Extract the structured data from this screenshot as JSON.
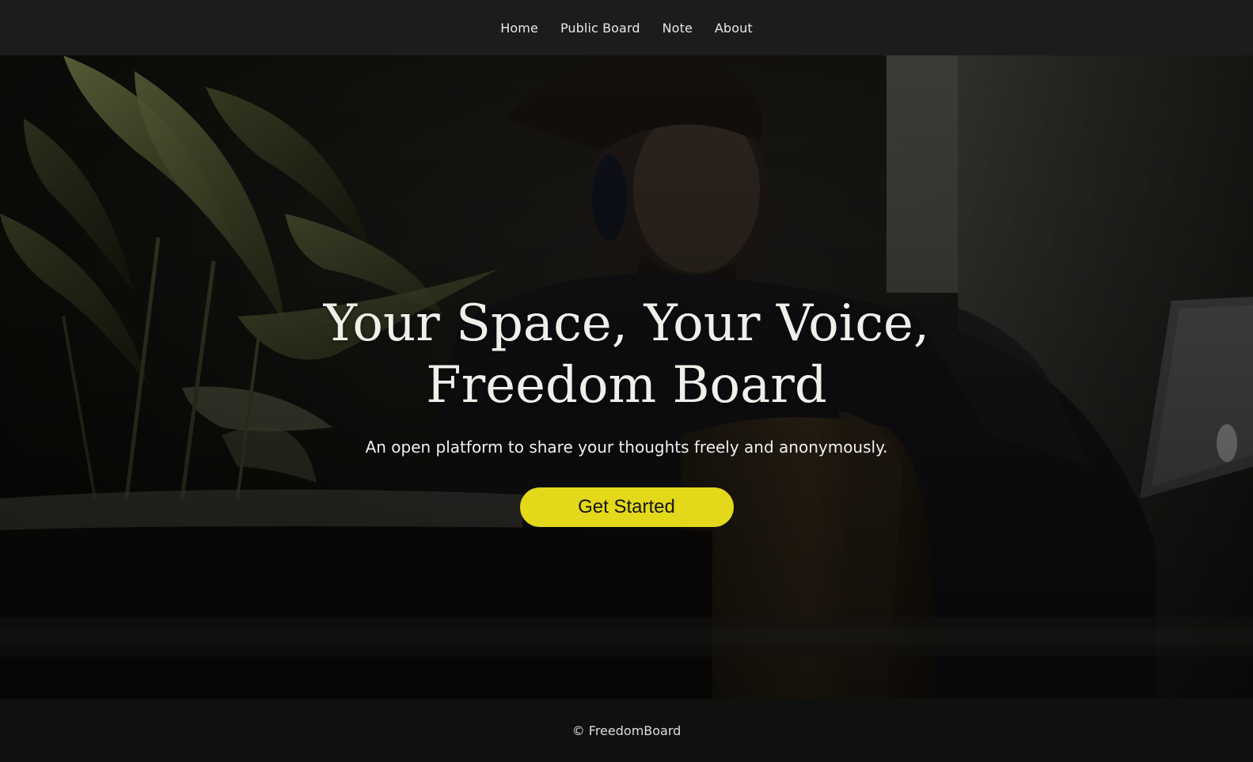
{
  "nav": {
    "items": [
      {
        "label": "Home"
      },
      {
        "label": "Public Board"
      },
      {
        "label": "Note"
      },
      {
        "label": "About"
      }
    ]
  },
  "hero": {
    "title_line1": "Your Space, Your Voice,",
    "title_line2": "Freedom Board",
    "subtitle": "An open platform to share your thoughts freely and anonymously.",
    "cta_label": "Get Started"
  },
  "footer": {
    "text": "© FreedomBoard"
  },
  "colors": {
    "nav_bg": "#1c1b1d",
    "cta_bg": "#e3d81a",
    "footer_bg": "#10110e",
    "title_color": "#f1efea"
  }
}
